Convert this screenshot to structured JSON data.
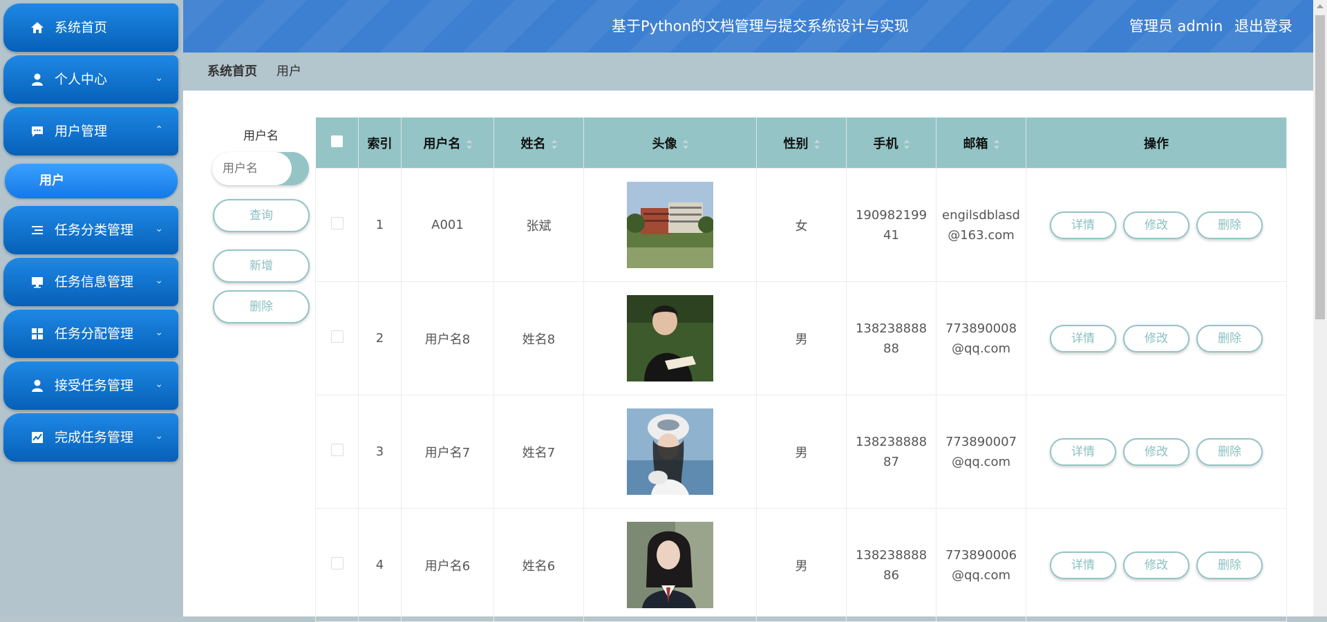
{
  "sidebar": {
    "items": [
      {
        "label": "系统首页",
        "icon": "home-icon"
      },
      {
        "label": "个人中心",
        "icon": "person-icon",
        "chevron": "⌄"
      },
      {
        "label": "用户管理",
        "icon": "chat-icon",
        "chevron": "⌃"
      },
      {
        "label": "任务分类管理",
        "icon": "list-icon",
        "chevron": "⌄"
      },
      {
        "label": "任务信息管理",
        "icon": "monitor-icon",
        "chevron": "⌄"
      },
      {
        "label": "任务分配管理",
        "icon": "grid-icon",
        "chevron": "⌄"
      },
      {
        "label": "接受任务管理",
        "icon": "person-icon",
        "chevron": "⌄"
      },
      {
        "label": "完成任务管理",
        "icon": "chart-icon",
        "chevron": "⌄"
      }
    ],
    "submenu_active": "用户"
  },
  "header": {
    "title": "基于Python的文档管理与提交系统设计与实现",
    "role": "管理员 admin",
    "logout": "退出登录"
  },
  "breadcrumb": {
    "home": "系统首页",
    "current": "用户"
  },
  "search": {
    "label": "用户名",
    "placeholder": "用户名",
    "query_button": "查询",
    "add_button": "新增",
    "delete_button": "删除"
  },
  "table": {
    "headers": [
      "索引",
      "用户名",
      "姓名",
      "头像",
      "性别",
      "手机",
      "邮箱",
      "操作"
    ],
    "actions": {
      "detail": "详情",
      "edit": "修改",
      "delete": "删除"
    },
    "rows": [
      {
        "index": "1",
        "username": "A001",
        "name": "张斌",
        "gender": "女",
        "phone": "19098219941",
        "email": "engilsdblasd@163.com"
      },
      {
        "index": "2",
        "username": "用户名8",
        "name": "姓名8",
        "gender": "男",
        "phone": "13823888888",
        "email": "773890008@qq.com"
      },
      {
        "index": "3",
        "username": "用户名7",
        "name": "姓名7",
        "gender": "男",
        "phone": "13823888887",
        "email": "773890007@qq.com"
      },
      {
        "index": "4",
        "username": "用户名6",
        "name": "姓名6",
        "gender": "男",
        "phone": "13823888886",
        "email": "773890006@qq.com"
      }
    ]
  },
  "colors": {
    "sidebar_button": "#0a6fd0",
    "header": "#3d7fd0",
    "table_header": "#94c4c6",
    "accent": "#8bc0c2"
  }
}
